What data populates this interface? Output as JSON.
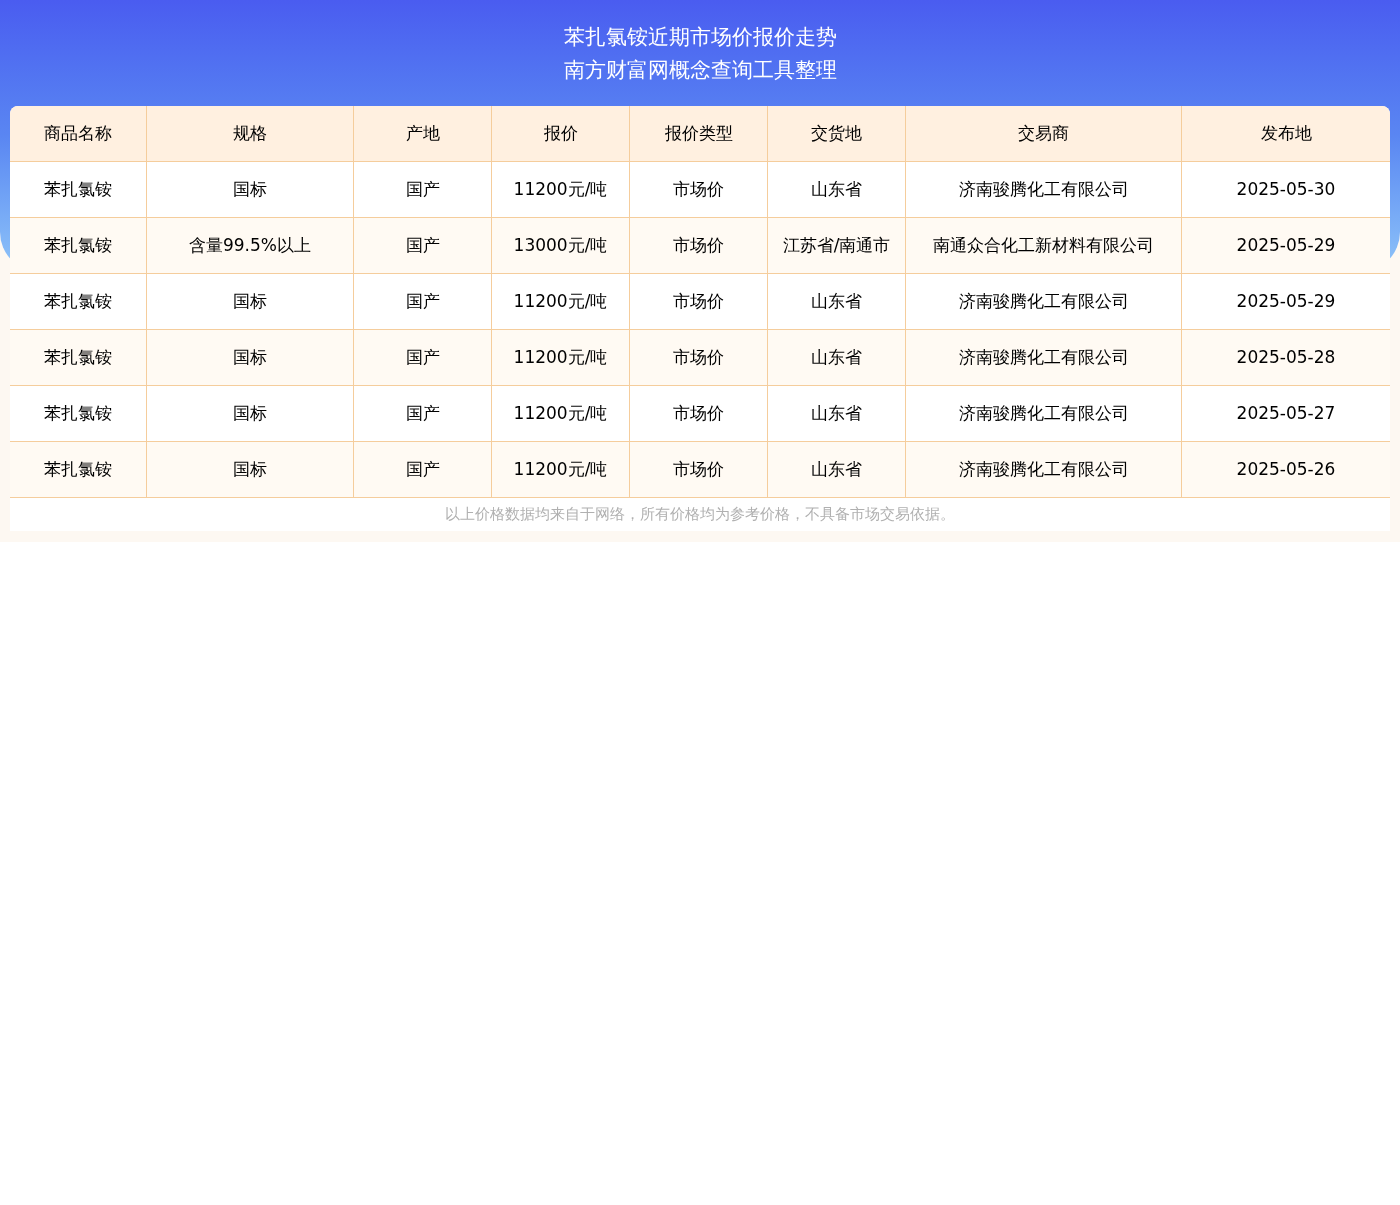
{
  "title_lines": [
    "苯扎氯铵近期市场价报价走势",
    "南方财富网概念查询工具整理"
  ],
  "table": {
    "columns": [
      "商品名称",
      "规格",
      "产地",
      "报价",
      "报价类型",
      "交货地",
      "交易商",
      "发布地"
    ],
    "rows": [
      [
        "苯扎氯铵",
        "国标",
        "国产",
        "11200元/吨",
        "市场价",
        "山东省",
        "济南骏腾化工有限公司",
        "2025-05-30"
      ],
      [
        "苯扎氯铵",
        "含量99.5%以上",
        "国产",
        "13000元/吨",
        "市场价",
        "江苏省/南通市",
        "南通众合化工新材料有限公司",
        "2025-05-29"
      ],
      [
        "苯扎氯铵",
        "国标",
        "国产",
        "11200元/吨",
        "市场价",
        "山东省",
        "济南骏腾化工有限公司",
        "2025-05-29"
      ],
      [
        "苯扎氯铵",
        "国标",
        "国产",
        "11200元/吨",
        "市场价",
        "山东省",
        "济南骏腾化工有限公司",
        "2025-05-28"
      ],
      [
        "苯扎氯铵",
        "国标",
        "国产",
        "11200元/吨",
        "市场价",
        "山东省",
        "济南骏腾化工有限公司",
        "2025-05-27"
      ],
      [
        "苯扎氯铵",
        "国标",
        "国产",
        "11200元/吨",
        "市场价",
        "山东省",
        "济南骏腾化工有限公司",
        "2025-05-26"
      ]
    ]
  },
  "note": "以上价格数据均来自于网络，所有价格均为参考价格，不具备市场交易依据。"
}
